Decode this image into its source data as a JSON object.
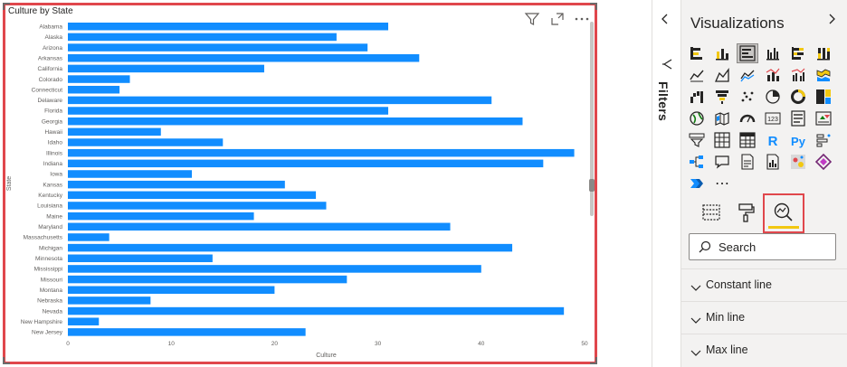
{
  "visual": {
    "title": "Culture by State",
    "header_icons": [
      "filter-icon",
      "focus-mode-icon",
      "more-options-icon"
    ]
  },
  "chart_data": {
    "type": "bar",
    "orientation": "horizontal",
    "title": "Culture by State",
    "xlabel": "Culture",
    "ylabel": "State",
    "xlim": [
      0,
      50
    ],
    "x_ticks": [
      "0",
      "10",
      "20",
      "30",
      "40",
      "50"
    ],
    "categories": [
      "Alabama",
      "Alaska",
      "Arizona",
      "Arkansas",
      "California",
      "Colorado",
      "Connecticut",
      "Delaware",
      "Florida",
      "Georgia",
      "Hawaii",
      "Idaho",
      "Illinois",
      "Indiana",
      "Iowa",
      "Kansas",
      "Kentucky",
      "Louisiana",
      "Maine",
      "Maryland",
      "Massachusetts",
      "Michigan",
      "Minnesota",
      "Mississippi",
      "Missouri",
      "Montana",
      "Nebraska",
      "Nevada",
      "New Hampshire",
      "New Jersey"
    ],
    "values": [
      31,
      26,
      29,
      34,
      19,
      6,
      5,
      41,
      31,
      44,
      9,
      15,
      49,
      46,
      12,
      21,
      24,
      25,
      18,
      37,
      4,
      43,
      14,
      40,
      27,
      20,
      8,
      48,
      3,
      23
    ],
    "color": "#118dff",
    "grid": false,
    "legend": "none"
  },
  "filters": {
    "label": "Filters"
  },
  "visualizations": {
    "title": "Visualizations",
    "icons": [
      "stacked-bar-chart-icon",
      "stacked-column-chart-icon",
      "clustered-bar-chart-icon",
      "clustered-column-chart-icon",
      "100-stacked-bar-chart-icon",
      "100-stacked-column-chart-icon",
      "line-chart-icon",
      "area-chart-icon",
      "stacked-area-chart-icon",
      "line-and-stacked-column-icon",
      "line-and-clustered-column-icon",
      "ribbon-chart-icon",
      "waterfall-chart-icon",
      "funnel-icon",
      "scatter-chart-icon",
      "pie-chart-icon",
      "donut-chart-icon",
      "treemap-icon",
      "map-icon",
      "filled-map-icon",
      "gauge-icon",
      "card-icon",
      "multi-row-card-icon",
      "kpi-icon",
      "slicer-icon",
      "table-icon",
      "matrix-icon",
      "r-visual-icon",
      "python-visual-icon",
      "key-influencers-icon",
      "decomposition-tree-icon",
      "qa-icon",
      "smart-narrative-icon",
      "paginated-report-icon",
      "arcgis-map-icon",
      "power-apps-icon",
      "power-automate-icon",
      "more-visuals-icon"
    ],
    "r_label": "R",
    "py_label": "Py",
    "card_label": "123",
    "more_label": "⋯",
    "tools": [
      "fields-icon",
      "format-icon",
      "analytics-icon"
    ],
    "search_placeholder": "Search",
    "sections": [
      "Constant line",
      "Min line",
      "Max line"
    ]
  },
  "colors": {
    "accent_border": "#e0474c",
    "bar": "#118dff",
    "pane_bg": "#f3f2f1",
    "active_underline": "#f2c811"
  }
}
